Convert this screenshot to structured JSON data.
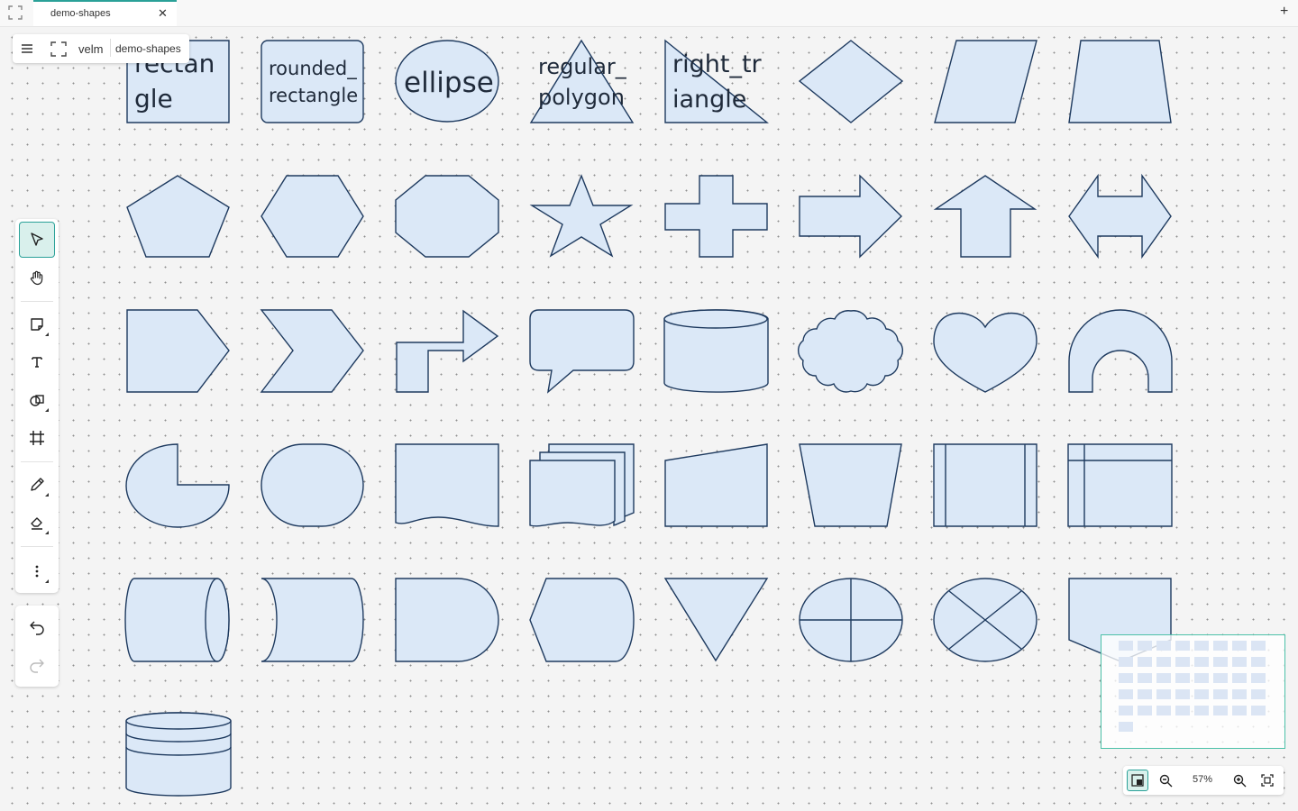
{
  "tabs": [
    {
      "label": "demo-shapes",
      "close_icon": "x-icon",
      "active": true
    }
  ],
  "new_tab_label": "+",
  "topmenu": {
    "app_name": "velm",
    "document_name": "demo-shapes",
    "menu_icon": "hamburger-menu-icon",
    "file_icon": "frame-icon"
  },
  "shape_labels": {
    "rectangle": [
      "rectan",
      "gle"
    ],
    "rounded_rectangle": [
      "rounded_",
      "rectangle"
    ],
    "ellipse": [
      "ellipse"
    ],
    "regular_polygon": [
      "regular_",
      "polygon"
    ],
    "right_triangle": [
      "right_tr",
      "iangle"
    ]
  },
  "tools": [
    {
      "name": "select",
      "icon": "cursor-icon",
      "active": true
    },
    {
      "name": "hand",
      "icon": "hand-icon"
    },
    {
      "name": "note",
      "icon": "sticky-note-icon"
    },
    {
      "name": "text",
      "icon": "text-icon"
    },
    {
      "name": "shapes",
      "icon": "shapes-icon"
    },
    {
      "name": "frame",
      "icon": "frame-grid-icon"
    },
    {
      "name": "pen",
      "icon": "pencil-icon"
    },
    {
      "name": "eraser",
      "icon": "eraser-icon"
    },
    {
      "name": "more",
      "icon": "more-vertical-icon"
    }
  ],
  "history": [
    {
      "name": "undo",
      "icon": "undo-icon",
      "enabled": true
    },
    {
      "name": "redo",
      "icon": "redo-icon",
      "enabled": false
    }
  ],
  "zoom": {
    "level": "57%",
    "toggle_minimap_icon": "minimap-icon",
    "zoom_out_icon": "zoom-out-icon",
    "zoom_in_icon": "zoom-in-icon",
    "fit_icon": "fit-to-screen-icon"
  },
  "colors": {
    "shape_fill": "#dbe8f7",
    "shape_stroke": "#1e3a5f",
    "accent": "#2aa198"
  }
}
